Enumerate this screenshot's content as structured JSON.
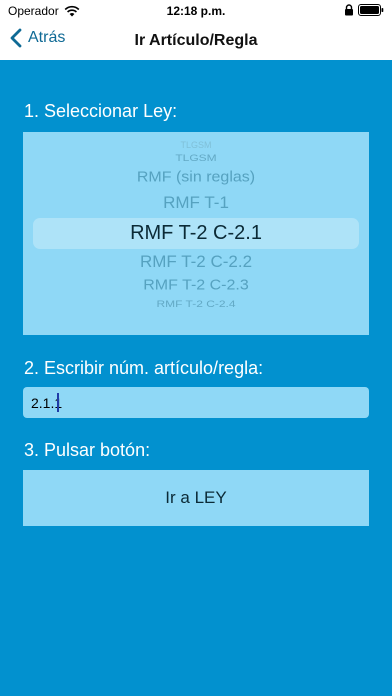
{
  "status_bar": {
    "carrier": "Operador",
    "time": "12:18 p.m."
  },
  "nav": {
    "back_label": "Atrás",
    "title": "Ir Artículo/Regla"
  },
  "form": {
    "step1_label": "1. Seleccionar Ley:",
    "picker": {
      "items": [
        "TLGSM",
        "TLGSM",
        "RMF (sin reglas)",
        "RMF T-1",
        "RMF T-2 C-2.1",
        "RMF T-2 C-2.2",
        "RMF T-2 C-2.3",
        "RMF T-2 C-2.4"
      ],
      "selected": "RMF T-2 C-2.1"
    },
    "step2_label": "2. Escribir núm. artículo/regla:",
    "article_input_value": "2.1.1",
    "step3_label": "3. Pulsar botón:",
    "go_button_label": "Ir a LEY"
  },
  "colors": {
    "background": "#0291cf",
    "field": "#8fd8f6",
    "nav_tint": "#0f6a95"
  },
  "icons": {
    "wifi": "wifi-icon",
    "lock": "lock-icon",
    "battery": "battery-icon",
    "back": "chevron-left-icon"
  }
}
